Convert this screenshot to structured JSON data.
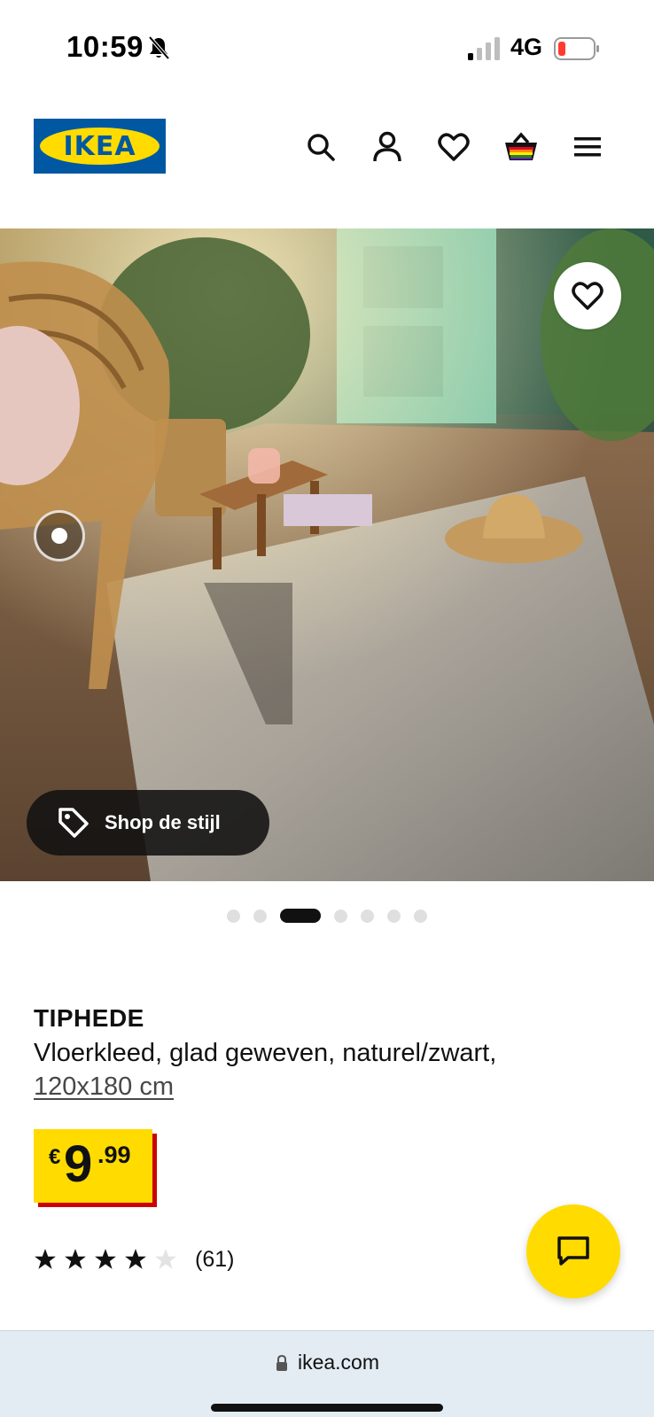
{
  "status_bar": {
    "time": "10:59",
    "network": "4G",
    "icons": [
      "bell-slash-icon",
      "signal-icon",
      "battery-low-icon"
    ]
  },
  "header": {
    "logo_text": "IKEA",
    "icons": [
      "search-icon",
      "account-icon",
      "heart-icon",
      "basket-icon",
      "menu-icon"
    ],
    "colors": {
      "logo_blue": "#0058a3",
      "logo_yellow": "#ffdb00"
    }
  },
  "hero": {
    "shop_style_label": "Shop de stijl",
    "favorite_icon": "heart-icon",
    "tag_icon": "tag-icon",
    "carousel": {
      "total": 7,
      "active_index": 2
    }
  },
  "product": {
    "name": "TIPHEDE",
    "description": "Vloerkleed, glad geweven, naturel/zwart,",
    "size": "120x180 cm",
    "price": {
      "currency": "€",
      "integer": "9",
      "decimal": ".99"
    },
    "rating": {
      "stars": 4,
      "max": 5,
      "count_label": "(61)"
    }
  },
  "chat_button": {
    "icon": "chat-icon",
    "color": "#ffdb00"
  },
  "browser": {
    "url": "ikea.com",
    "icon": "lock-icon"
  }
}
